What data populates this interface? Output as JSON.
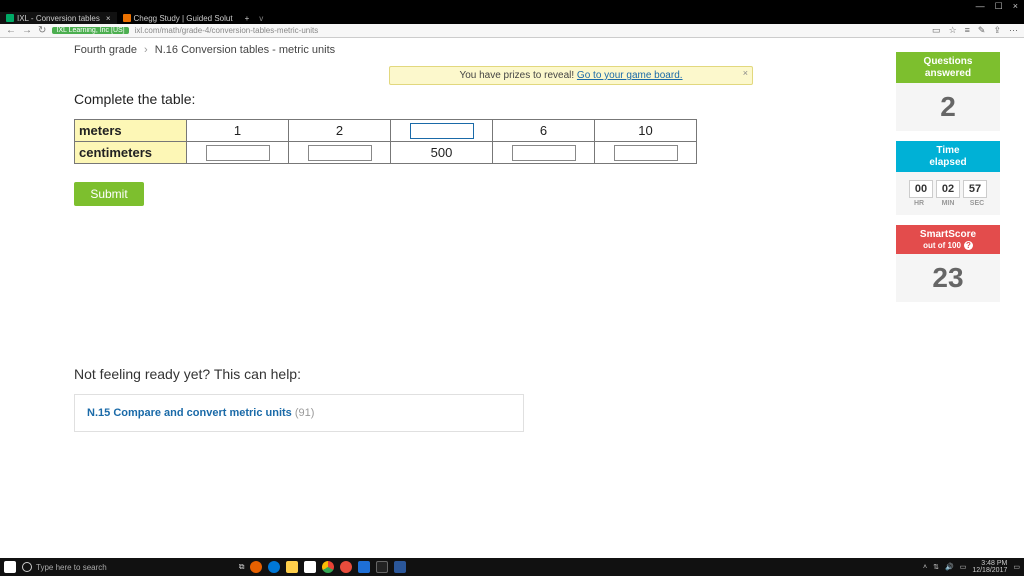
{
  "window": {
    "min": "—",
    "max": "☐",
    "close": "×"
  },
  "tabs": [
    {
      "title": "IXL - Conversion tables",
      "active": true
    },
    {
      "title": "Chegg Study | Guided Solut",
      "active": false
    },
    {
      "add": "+"
    }
  ],
  "address": {
    "site": "IXL Learning, Inc [US]",
    "url": "ixl.com/math/grade-4/conversion-tables-metric-units",
    "star": "☆"
  },
  "breadcrumb": {
    "level": "Fourth grade",
    "skill": "N.16 Conversion tables - metric units"
  },
  "prize": {
    "text": "You have prizes to reveal! ",
    "link": "Go to your game board."
  },
  "prompt": "Complete the table:",
  "table": {
    "row1_label": "meters",
    "row2_label": "centimeters",
    "m": [
      "1",
      "2",
      "",
      "6",
      "10"
    ],
    "cm": [
      "",
      "",
      "500",
      "",
      ""
    ]
  },
  "submit": "Submit",
  "sidebar": {
    "qa": {
      "title1": "Questions",
      "title2": "answered",
      "value": "2"
    },
    "te": {
      "title1": "Time",
      "title2": "elapsed",
      "hr": "00",
      "min": "02",
      "sec": "57",
      "lhr": "HR",
      "lmin": "MIN",
      "lsec": "SEC"
    },
    "ss": {
      "title": "SmartScore",
      "sub": "out of 100",
      "value": "23"
    }
  },
  "help": {
    "heading": "Not feeling ready yet? This can help:",
    "code": "N.15",
    "link": "Compare and convert metric units",
    "score": "(91)"
  },
  "taskbar": {
    "search": "Type here to search",
    "time": "3:48 PM",
    "date": "12/18/2017"
  }
}
